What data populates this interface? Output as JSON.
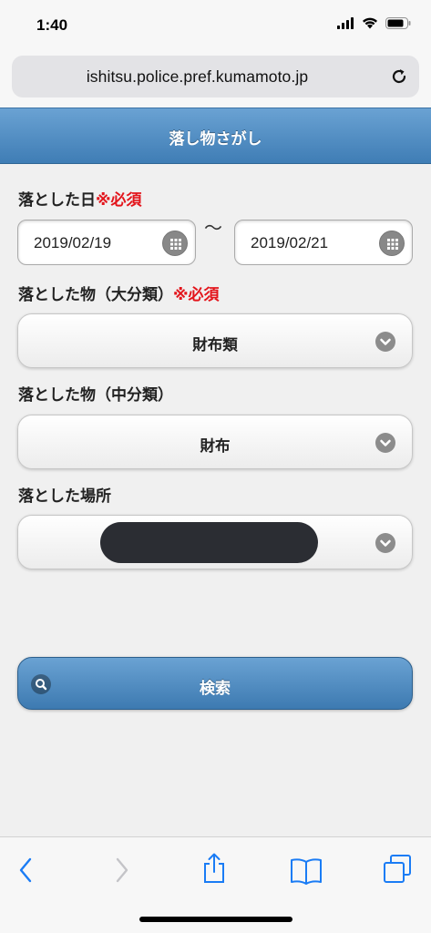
{
  "status_bar": {
    "time": "1:40",
    "icons": [
      "signal-icon",
      "wifi-icon",
      "battery-icon"
    ]
  },
  "browser": {
    "url": "ishitsu.police.pref.kumamoto.jp",
    "reload_icon": "reload-icon"
  },
  "header": {
    "title": "落し物さがし",
    "color": "#4f8cc4"
  },
  "form": {
    "date_label": "落とした日",
    "required": "※必須",
    "date_from": "2019/02/19",
    "date_separator": "〜",
    "date_to": "2019/02/21",
    "major_label": "落とした物（大分類）",
    "major_value": "財布類",
    "minor_label": "落とした物（中分類）",
    "minor_value": "財布",
    "place_label": "落とした場所",
    "place_value": "",
    "required_color": "#e3141b"
  },
  "search_button": {
    "label": "検索",
    "icon": "search-icon"
  },
  "toolbar": {
    "items": [
      "back-icon",
      "forward-icon",
      "share-icon",
      "bookmarks-icon",
      "tabs-icon"
    ],
    "accent": "#1a7cf5"
  }
}
